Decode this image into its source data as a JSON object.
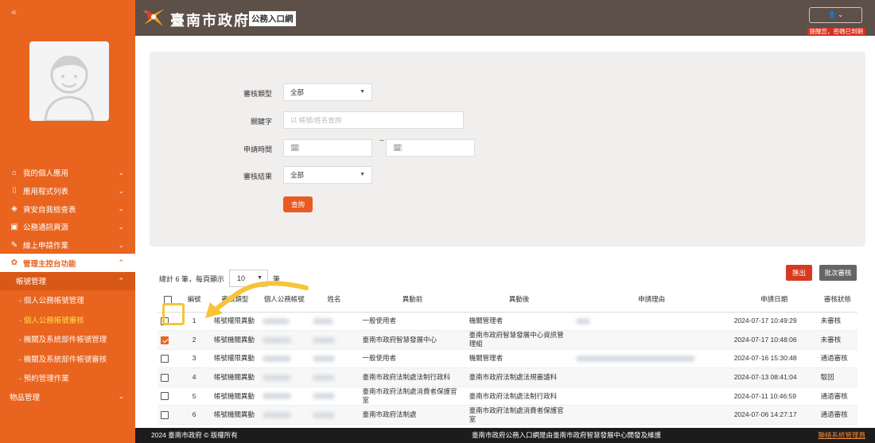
{
  "header": {
    "collapse_icon": "«",
    "title": "臺南市政府",
    "badge": "公務入口網",
    "user_icon": "user-icon",
    "warning": "提醒您，密碼已到期"
  },
  "sidebar": {
    "items": [
      {
        "label": "我的個人應用",
        "icon": "home-icon"
      },
      {
        "label": "應用程式列表",
        "icon": "grid-icon"
      },
      {
        "label": "資安自我檢查表",
        "icon": "shield-icon"
      },
      {
        "label": "公務通訊資源",
        "icon": "book-icon"
      },
      {
        "label": "線上申請作業",
        "icon": "pen-icon"
      },
      {
        "label": "管理主控台功能",
        "icon": "gear-icon"
      }
    ],
    "submenu": {
      "label": "帳號管理"
    },
    "leaves": [
      "- 個人公務帳號管理",
      "- 個人公務帳號審核",
      "- 機關及系統部件帳號管理",
      "- 機關及系統部件帳號審核",
      "- 預約管理作業"
    ],
    "last": {
      "label": "物品管理"
    }
  },
  "filter": {
    "review_type_label": "審核類型",
    "review_type_value": "全部",
    "keyword_label": "關鍵字",
    "keyword_placeholder": "以 帳號/姓名查詢",
    "date_label": "申請時間",
    "date_tilde": "~",
    "result_label": "審核結果",
    "result_value": "全部",
    "query_label": "查詢"
  },
  "results": {
    "summary_prefix": "總計 6 筆，每頁顯示",
    "page_size": "10",
    "summary_suffix": "筆",
    "export_label": "匯出",
    "batch_label": "批次審核"
  },
  "table": {
    "headers": [
      "編號",
      "審核類型",
      "個人公務帳號",
      "姓名",
      "異動前",
      "異動後",
      "申請理由",
      "申請日期",
      "審核狀態"
    ],
    "rows": [
      {
        "no": "1",
        "type": "帳號權限異動",
        "before": "一般使用者",
        "after": "機關管理者",
        "date": "2024-07-17 10:49:29",
        "status": "未審核"
      },
      {
        "no": "2",
        "type": "帳號機關異動",
        "before": "臺南市政府智慧發展中心",
        "after": "臺南市政府智慧發展中心資訊管理組",
        "date": "2024-07-17 10:48:06",
        "status": "未審核"
      },
      {
        "no": "3",
        "type": "帳號權限異動",
        "before": "一般使用者",
        "after": "機關管理者",
        "date": "2024-07-16 15:30:48",
        "status": "通過審核"
      },
      {
        "no": "4",
        "type": "帳號機關異動",
        "before": "臺南市政府法制處法制行政科",
        "after": "臺南市政府法制處法規審議科",
        "date": "2024-07-13 08:41:04",
        "status": "駁回"
      },
      {
        "no": "5",
        "type": "帳號機關異動",
        "before": "臺南市政府法制處消費者保護官室",
        "after": "臺南市政府法制處法制行政科",
        "date": "2024-07-11 10:46:59",
        "status": "通過審核"
      },
      {
        "no": "6",
        "type": "帳號機關異動",
        "before": "臺南市政府法制處",
        "after": "臺南市政府法制處消費者保護官室",
        "date": "2024-07-06 14:27:17",
        "status": "通過審核"
      }
    ]
  },
  "footer": {
    "left": "2024 臺南市政府 © 版權所有",
    "mid": "臺南市政府公務入口網是由臺南市政府智慧發展中心開發及維護",
    "right": "聯絡系統管理員"
  },
  "colors": {
    "sidebar": "#e8641f",
    "topbar": "#5d5049",
    "highlight": "#f7c338"
  }
}
